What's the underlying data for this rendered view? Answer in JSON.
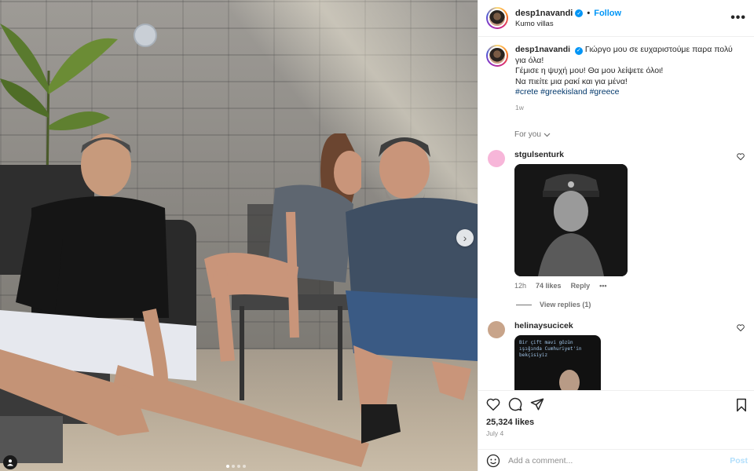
{
  "post": {
    "author": "desp1navandi",
    "location": "Kumo villas",
    "follow_label": "Follow",
    "separator": "•",
    "more_label": "•••",
    "carousel": {
      "total": 4,
      "active": 0
    }
  },
  "caption": {
    "username": "desp1navandi",
    "line1": "Γιώργο μου σε ευχαριστούμε παρα πολύ για όλα!",
    "line2": "Γέμισε η ψυχή μου! Θα μου λείψετε όλοι!",
    "line3": "Να πιείτε μια ρακί και για μένα!",
    "tags": [
      "#crete",
      "#greekisland",
      "#greece"
    ],
    "time": "1w"
  },
  "sort": {
    "label": "For you"
  },
  "comments": [
    {
      "username": "stgulsenturk",
      "time": "12h",
      "likes": "74 likes",
      "reply": "Reply",
      "more": "•••",
      "view_replies": "View replies (1)",
      "avatar_color": "#f7b6d9"
    },
    {
      "username": "helinaysucicek",
      "image_text": "Bir çift mavi gözün ışığında Cumhuriyet'in bekçisiyiz",
      "avatar_color": "#c8a48a"
    }
  ],
  "actions": {
    "likes": "25,324 likes",
    "date": "July 4"
  },
  "composer": {
    "placeholder": "Add a comment...",
    "post_label": "Post"
  },
  "colors": {
    "accent": "#0095f6",
    "hashtag": "#00376b",
    "muted": "#737373"
  }
}
